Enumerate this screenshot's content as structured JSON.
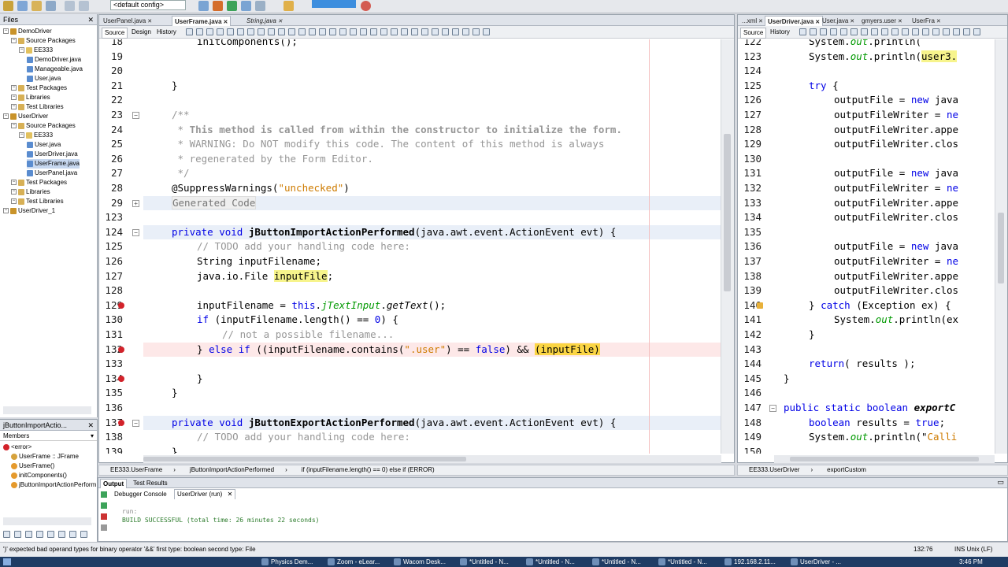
{
  "toolbar": {
    "config_label": "<default config>"
  },
  "files_panel": {
    "tab_label": "Files",
    "tree": [
      {
        "label": "DemoDriver",
        "indent": 0
      },
      {
        "label": "Source Packages",
        "indent": 1
      },
      {
        "label": "EE333",
        "indent": 2
      },
      {
        "label": "DemoDriver.java",
        "indent": 3
      },
      {
        "label": "Manageable.java",
        "indent": 3
      },
      {
        "label": "User.java",
        "indent": 3
      },
      {
        "label": "Test Packages",
        "indent": 1
      },
      {
        "label": "Libraries",
        "indent": 1
      },
      {
        "label": "Test Libraries",
        "indent": 1
      },
      {
        "label": "UserDriver",
        "indent": 0
      },
      {
        "label": "Source Packages",
        "indent": 1
      },
      {
        "label": "EE333",
        "indent": 2
      },
      {
        "label": "User.java",
        "indent": 3
      },
      {
        "label": "UserDriver.java",
        "indent": 3
      },
      {
        "label": "UserFrame.java",
        "indent": 3
      },
      {
        "label": "UserPanel.java",
        "indent": 3
      },
      {
        "label": "Test Packages",
        "indent": 1
      },
      {
        "label": "Libraries",
        "indent": 1
      },
      {
        "label": "Test Libraries",
        "indent": 1
      },
      {
        "label": "UserDriver_1",
        "indent": 0
      }
    ]
  },
  "members_panel": {
    "tab_label": "jButtonImportActio...",
    "filter": "Members",
    "items": [
      "<error>",
      "UserFrame :: JFrame",
      "UserFrame()",
      "initComponents()",
      "jButtonImportActionPerform"
    ]
  },
  "left_editor": {
    "tabs": [
      "UserPanel.java",
      "UserFrame.java",
      "String.java"
    ],
    "subtabs": [
      "Source",
      "Design",
      "History"
    ],
    "lines": [
      {
        "n": "18",
        "code": "initComponents();"
      },
      {
        "n": "19",
        "code": ""
      },
      {
        "n": "20",
        "code": ""
      },
      {
        "n": "21",
        "code": "}"
      },
      {
        "n": "22",
        "code": ""
      },
      {
        "n": "23",
        "code": "/**"
      },
      {
        "n": "24",
        "code": " * This method is called from within the constructor to initialize the form."
      },
      {
        "n": "25",
        "code": " * WARNING: Do NOT modify this code. The content of this method is always"
      },
      {
        "n": "26",
        "code": " * regenerated by the Form Editor."
      },
      {
        "n": "27",
        "code": " */"
      },
      {
        "n": "28",
        "code": "@SuppressWarnings(\"unchecked\")"
      },
      {
        "n": "29",
        "code": "Generated Code"
      },
      {
        "n": "123",
        "code": ""
      },
      {
        "n": "124",
        "code": "private void jButtonImportActionPerformed(java.awt.event.ActionEvent evt) {"
      },
      {
        "n": "125",
        "code": "// TODO add your handling code here:"
      },
      {
        "n": "126",
        "code": "String inputFilename;"
      },
      {
        "n": "127",
        "code": "java.io.File inputFile;"
      },
      {
        "n": "128",
        "code": ""
      },
      {
        "n": "129",
        "code": "inputFilename = this.jTextInput.getText();"
      },
      {
        "n": "130",
        "code": "if (inputFilename.length() == 0) {"
      },
      {
        "n": "131",
        "code": "// not a possible filename..."
      },
      {
        "n": "132",
        "code": "} else if ((inputFilename.contains(\".user\") == false) && (inputFile)"
      },
      {
        "n": "133",
        "code": ""
      },
      {
        "n": "134",
        "code": "}"
      },
      {
        "n": "135",
        "code": "}"
      },
      {
        "n": "136",
        "code": ""
      },
      {
        "n": "137",
        "code": "private void jButtonExportActionPerformed(java.awt.event.ActionEvent evt) {"
      },
      {
        "n": "138",
        "code": "// TODO add your handling code here:"
      },
      {
        "n": "139",
        "code": "}"
      }
    ]
  },
  "right_editor": {
    "tabs": [
      "...xml",
      "UserDriver.java",
      "User.java",
      "gmyers.user",
      "UserFra"
    ],
    "subtabs": [
      "Source",
      "History"
    ],
    "lines": [
      {
        "n": "122",
        "code": "System.out.println("
      },
      {
        "n": "123",
        "code": "System.out.println(user3."
      },
      {
        "n": "124",
        "code": ""
      },
      {
        "n": "125",
        "code": "try {"
      },
      {
        "n": "126",
        "code": "outputFile = new java"
      },
      {
        "n": "127",
        "code": "outputFileWriter = ne"
      },
      {
        "n": "128",
        "code": "outputFileWriter.appe"
      },
      {
        "n": "129",
        "code": "outputFileWriter.clos"
      },
      {
        "n": "130",
        "code": ""
      },
      {
        "n": "131",
        "code": "outputFile = new java"
      },
      {
        "n": "132",
        "code": "outputFileWriter = ne"
      },
      {
        "n": "133",
        "code": "outputFileWriter.appe"
      },
      {
        "n": "134",
        "code": "outputFileWriter.clos"
      },
      {
        "n": "135",
        "code": ""
      },
      {
        "n": "136",
        "code": "outputFile = new java"
      },
      {
        "n": "137",
        "code": "outputFileWriter = ne"
      },
      {
        "n": "138",
        "code": "outputFileWriter.appe"
      },
      {
        "n": "139",
        "code": "outputFileWriter.clos"
      },
      {
        "n": "140",
        "code": "} catch (Exception ex) {"
      },
      {
        "n": "141",
        "code": "System.out.println(ex"
      },
      {
        "n": "142",
        "code": "}"
      },
      {
        "n": "143",
        "code": ""
      },
      {
        "n": "144",
        "code": "return( results );"
      },
      {
        "n": "145",
        "code": "}"
      },
      {
        "n": "146",
        "code": ""
      },
      {
        "n": "147",
        "code": "public static boolean exportC"
      },
      {
        "n": "148",
        "code": "boolean results = true;"
      },
      {
        "n": "149",
        "code": "System.out.println(\"Calli"
      },
      {
        "n": "150",
        "code": ""
      }
    ]
  },
  "breadcrumbs_left": [
    "EE333.UserFrame",
    "jButtonImportActionPerformed",
    "if (inputFilename.length() == 0) else if (ERROR)"
  ],
  "breadcrumbs_right": [
    "EE333.UserDriver",
    "exportCustom"
  ],
  "output": {
    "tabs": [
      "Output",
      "Test Results"
    ],
    "subtabs": [
      "Debugger Console",
      "UserDriver (run)"
    ],
    "lines": [
      "run:",
      "BUILD SUCCESSFUL (total time: 26 minutes 22 seconds)"
    ]
  },
  "status": {
    "message": "')' expected  bad operand types for binary operator '&&'  first type:  boolean  second type: File",
    "position": "132:76",
    "mode": "INS Unix (LF)"
  },
  "taskbar": {
    "items": [
      "Physics Dem...",
      "Zoom - eLear...",
      "Wacom Desk...",
      "*Untitled - N...",
      "*Untitled - N...",
      "*Untitled - N...",
      "*Untitled - N...",
      "192.168.2.11...",
      "UserDriver - ..."
    ],
    "clock": "3:46 PM"
  },
  "colors": {
    "keyword": "#0000e6",
    "comment": "#969696",
    "string": "#ce7b00",
    "error": "#d3222a",
    "highlight": "#f7f48c"
  }
}
